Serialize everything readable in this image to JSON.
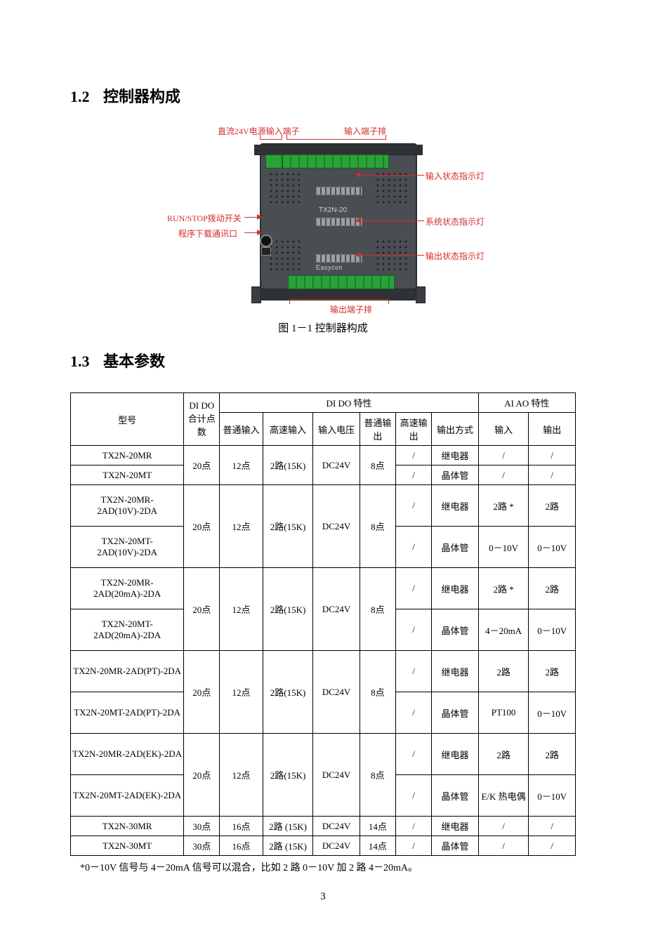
{
  "sections": {
    "s12_num": "1.2",
    "s12_title": "控制器构成",
    "s13_num": "1.3",
    "s13_title": "基本参数"
  },
  "figure": {
    "caption": "图 1－1   控制器构成",
    "model_text": "TX2N-20",
    "brand": "Easycon",
    "callouts": {
      "dc24v": "直流24V电源输入端子",
      "in_terminal": "输入端子排",
      "in_status": "输入状态指示灯",
      "run_stop": "RUN/STOP拨动开关",
      "download": "程序下载通讯口",
      "sys_status": "系统状态指示灯",
      "out_status": "输出状态指示灯",
      "out_terminal": "输出端子排"
    }
  },
  "table": {
    "headers": {
      "model": "型号",
      "dido_sum_top": "DI DO",
      "dido_sum_bot": "合计点数",
      "dido_char": "DI DO 特性",
      "aiao_char": "AI AO 特性",
      "normal_in": "普通输入",
      "hs_in": "高速输入",
      "in_voltage": "输入电压",
      "normal_out": "普通输出",
      "hs_out": "高速输出",
      "out_mode": "输出方式",
      "ai_in": "输入",
      "ao_out": "输出"
    },
    "groups": [
      {
        "sum": "20点",
        "nin": "12点",
        "hin": "2路(15K)",
        "v": "DC24V",
        "nout": "8点",
        "rows": [
          {
            "model": "TX2N-20MR",
            "hout": "/",
            "mode": "继电器",
            "ai": "/",
            "ao": "/"
          },
          {
            "model": "TX2N-20MT",
            "hout": "/",
            "mode": "晶体管",
            "ai": "/",
            "ao": "/"
          }
        ]
      },
      {
        "sum": "20点",
        "nin": "12点",
        "hin": "2路(15K)",
        "v": "DC24V",
        "nout": "8点",
        "ai_top": "2路 *",
        "ai_bot": "0－10V",
        "ao_top": "2路",
        "ao_bot": "0－10V",
        "rows": [
          {
            "model": "TX2N-20MR-2AD(10V)-2DA",
            "hout": "/",
            "mode": "继电器"
          },
          {
            "model": "TX2N-20MT-2AD(10V)-2DA",
            "hout": "/",
            "mode": "晶体管"
          }
        ]
      },
      {
        "sum": "20点",
        "nin": "12点",
        "hin": "2路(15K)",
        "v": "DC24V",
        "nout": "8点",
        "ai_top": "2路 *",
        "ai_bot": "4－20mA",
        "ao_top": "2路",
        "ao_bot": "0－10V",
        "rows": [
          {
            "model": "TX2N-20MR-2AD(20mA)-2DA",
            "hout": "/",
            "mode": "继电器"
          },
          {
            "model": "TX2N-20MT-2AD(20mA)-2DA",
            "hout": "/",
            "mode": "晶体管"
          }
        ]
      },
      {
        "sum": "20点",
        "nin": "12点",
        "hin": "2路(15K)",
        "v": "DC24V",
        "nout": "8点",
        "ai_top": "2路",
        "ai_bot": "PT100",
        "ao_top": "2路",
        "ao_bot": "0－10V",
        "rows": [
          {
            "model": "TX2N-20MR-2AD(PT)-2DA",
            "hout": "/",
            "mode": "继电器"
          },
          {
            "model": "TX2N-20MT-2AD(PT)-2DA",
            "hout": "/",
            "mode": "晶体管"
          }
        ]
      },
      {
        "sum": "20点",
        "nin": "12点",
        "hin": "2路(15K)",
        "v": "DC24V",
        "nout": "8点",
        "ai_top": "2路",
        "ai_bot": "E/K 热电偶",
        "ao_top": "2路",
        "ao_bot": "0－10V",
        "rows": [
          {
            "model": "TX2N-20MR-2AD(EK)-2DA",
            "hout": "/",
            "mode": "继电器"
          },
          {
            "model": "TX2N-20MT-2AD(EK)-2DA",
            "hout": "/",
            "mode": "晶体管"
          }
        ]
      }
    ],
    "singles": [
      {
        "model": "TX2N-30MR",
        "sum": "30点",
        "nin": "16点",
        "hin": "2路 (15K)",
        "v": "DC24V",
        "nout": "14点",
        "hout": "/",
        "mode": "继电器",
        "ai": "/",
        "ao": "/"
      },
      {
        "model": "TX2N-30MT",
        "sum": "30点",
        "nin": "16点",
        "hin": "2路 (15K)",
        "v": "DC24V",
        "nout": "14点",
        "hout": "/",
        "mode": "晶体管",
        "ai": "/",
        "ao": "/"
      }
    ],
    "footnote": "*0－10V 信号与 4－20mA 信号可以混合，比如 2 路 0－10V 加 2 路 4－20mA。"
  },
  "page_number": "3"
}
